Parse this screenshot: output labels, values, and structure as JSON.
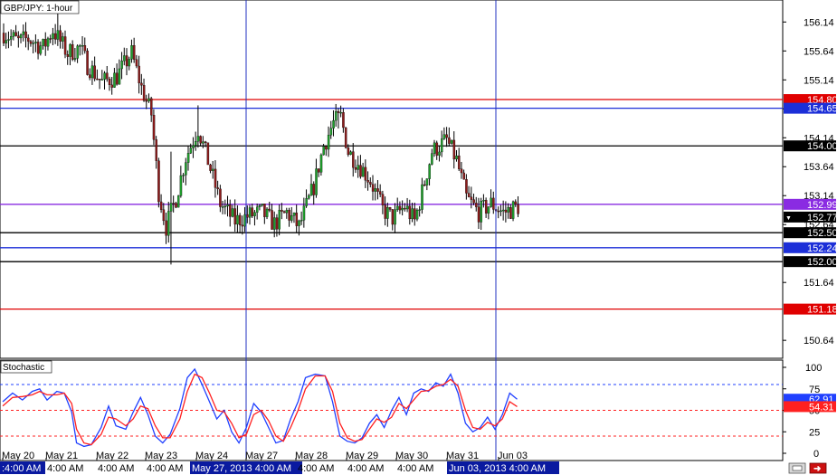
{
  "window": {
    "title": "GBP/JPY: 1-hour"
  },
  "colors": {
    "background": "#ffffff",
    "candle_up": "#1f9e2c",
    "candle_down": "#8b1a1a",
    "wick": "#000000",
    "line_red": "#e00000",
    "line_blue": "#1c2fd8",
    "line_black": "#000000",
    "line_purple": "#8a2be2",
    "stoch_k": "#2040ff",
    "stoch_d": "#ff2020",
    "stoch_level_blue": "#2040ff",
    "stoch_level_red": "#ff2020",
    "crosshair": "#2030c0",
    "highlight_label_bg": "#0a1aa0",
    "price_label_current_bg": "#000000"
  },
  "chart_data": [
    {
      "type": "candlestick",
      "title": "GBP/JPY: 1-hour",
      "ylim": [
        150.33,
        156.52
      ],
      "yticks": [
        156.14,
        155.64,
        155.14,
        154.64,
        154.14,
        153.64,
        153.14,
        152.64,
        151.64,
        150.64
      ],
      "horizontal_lines": [
        {
          "value": 154.8,
          "label": "154.80",
          "color": "red"
        },
        {
          "value": 154.65,
          "label": "154.65",
          "color": "blue"
        },
        {
          "value": 154.0,
          "label": "154.00",
          "color": "black"
        },
        {
          "value": 152.99,
          "label": "152.99",
          "color": "purple"
        },
        {
          "value": 152.5,
          "label": "152.50",
          "color": "black"
        },
        {
          "value": 152.24,
          "label": "152.24",
          "color": "blue"
        },
        {
          "value": 152.0,
          "label": "152.00",
          "color": "black"
        },
        {
          "value": 151.18,
          "label": "151.18",
          "color": "red"
        }
      ],
      "current_price": {
        "value": 152.77,
        "label": "152.77"
      },
      "price_path": [
        [
          0,
          155.95
        ],
        [
          6,
          155.8
        ],
        [
          10,
          155.85
        ],
        [
          16,
          155.7
        ],
        [
          20,
          156.0
        ],
        [
          26,
          155.6
        ],
        [
          31,
          155.7
        ],
        [
          34,
          155.4
        ],
        [
          40,
          155.1
        ],
        [
          46,
          155.2
        ],
        [
          52,
          155.6
        ],
        [
          56,
          155.0
        ],
        [
          60,
          154.55
        ],
        [
          63,
          153.2
        ],
        [
          66,
          152.6
        ],
        [
          70,
          153.1
        ],
        [
          74,
          153.8
        ],
        [
          79,
          154.3
        ],
        [
          84,
          153.6
        ],
        [
          88,
          153.0
        ],
        [
          94,
          152.7
        ],
        [
          100,
          152.8
        ],
        [
          105,
          152.85
        ],
        [
          110,
          152.65
        ],
        [
          115,
          152.85
        ],
        [
          120,
          152.6
        ],
        [
          126,
          153.3
        ],
        [
          130,
          154.0
        ],
        [
          134,
          154.4
        ],
        [
          137,
          154.5
        ],
        [
          140,
          153.9
        ],
        [
          144,
          153.7
        ],
        [
          149,
          153.4
        ],
        [
          154,
          152.9
        ],
        [
          158,
          152.75
        ],
        [
          163,
          152.95
        ],
        [
          167,
          152.7
        ],
        [
          170,
          153.2
        ],
        [
          174,
          153.9
        ],
        [
          180,
          154.1
        ],
        [
          184,
          153.75
        ],
        [
          188,
          153.1
        ],
        [
          193,
          152.85
        ],
        [
          198,
          153.0
        ],
        [
          203,
          152.85
        ],
        [
          209,
          152.95
        ]
      ],
      "spikes": [
        {
          "i": 68,
          "high": 153.9,
          "low": 151.95
        },
        {
          "i": 79,
          "high": 154.7,
          "low": 154.1
        },
        {
          "i": 136,
          "high": 154.65,
          "low": 154.3
        },
        {
          "i": 183,
          "high": 154.2,
          "low": 153.7
        },
        {
          "i": 22,
          "high": 156.4,
          "low": 155.9
        }
      ],
      "candle_count": 210,
      "xlabels_date": [
        "May 20",
        "May 21",
        "May 22",
        "May 23",
        "May 24",
        "May 27",
        "May 28",
        "May 29",
        "May 30",
        "May 31",
        "Jun 03"
      ],
      "xlabels_time": [
        ":4:00 AM",
        "4:00 AM",
        "4:00 AM",
        "4:00 AM",
        "May 27, 2013 4:00 AM",
        "4:00 AM",
        "4:00 AM",
        "4:00 AM",
        "Jun 03, 2013 4:00 AM"
      ],
      "crosshair_labels": [
        "May 27, 2013 4:00 AM",
        "Jun 03, 2013 4:00 AM"
      ]
    },
    {
      "type": "line",
      "title": "Stochastic",
      "ylim": [
        0,
        100
      ],
      "yticks": [
        100,
        75,
        50,
        25,
        0
      ],
      "levels": [
        80,
        20,
        50
      ],
      "current_values": [
        {
          "label": "62.91",
          "value": 62.91,
          "color": "blue"
        },
        {
          "label": "54.31",
          "value": 54.31,
          "color": "red"
        }
      ],
      "series": [
        {
          "name": "%K",
          "color": "blue",
          "points": [
            [
              0,
              60
            ],
            [
              4,
              70
            ],
            [
              8,
              62
            ],
            [
              12,
              72
            ],
            [
              15,
              75
            ],
            [
              18,
              62
            ],
            [
              22,
              72
            ],
            [
              25,
              70
            ],
            [
              28,
              48
            ],
            [
              30,
              12
            ],
            [
              33,
              8
            ],
            [
              36,
              10
            ],
            [
              40,
              30
            ],
            [
              43,
              55
            ],
            [
              46,
              32
            ],
            [
              50,
              28
            ],
            [
              53,
              48
            ],
            [
              56,
              65
            ],
            [
              59,
              45
            ],
            [
              62,
              20
            ],
            [
              65,
              12
            ],
            [
              68,
              22
            ],
            [
              72,
              52
            ],
            [
              75,
              88
            ],
            [
              78,
              98
            ],
            [
              81,
              80
            ],
            [
              84,
              60
            ],
            [
              87,
              40
            ],
            [
              90,
              50
            ],
            [
              93,
              25
            ],
            [
              96,
              12
            ],
            [
              99,
              30
            ],
            [
              102,
              58
            ],
            [
              105,
              48
            ],
            [
              108,
              30
            ],
            [
              111,
              12
            ],
            [
              114,
              15
            ],
            [
              117,
              40
            ],
            [
              120,
              60
            ],
            [
              123,
              88
            ],
            [
              127,
              92
            ],
            [
              131,
              90
            ],
            [
              134,
              60
            ],
            [
              137,
              20
            ],
            [
              140,
              14
            ],
            [
              143,
              12
            ],
            [
              146,
              18
            ],
            [
              149,
              35
            ],
            [
              152,
              45
            ],
            [
              155,
              30
            ],
            [
              158,
              50
            ],
            [
              161,
              65
            ],
            [
              164,
              45
            ],
            [
              167,
              70
            ],
            [
              170,
              75
            ],
            [
              173,
              72
            ],
            [
              176,
              82
            ],
            [
              179,
              78
            ],
            [
              182,
              92
            ],
            [
              185,
              70
            ],
            [
              188,
              35
            ],
            [
              191,
              25
            ],
            [
              194,
              30
            ],
            [
              197,
              42
            ],
            [
              200,
              28
            ],
            [
              203,
              45
            ],
            [
              206,
              70
            ],
            [
              209,
              62.91
            ]
          ]
        },
        {
          "name": "%D",
          "color": "red",
          "points": [
            [
              0,
              55
            ],
            [
              4,
              65
            ],
            [
              8,
              66
            ],
            [
              12,
              68
            ],
            [
              15,
              72
            ],
            [
              18,
              68
            ],
            [
              22,
              68
            ],
            [
              25,
              70
            ],
            [
              28,
              58
            ],
            [
              30,
              28
            ],
            [
              33,
              12
            ],
            [
              36,
              10
            ],
            [
              40,
              22
            ],
            [
              43,
              42
            ],
            [
              46,
              40
            ],
            [
              50,
              32
            ],
            [
              53,
              40
            ],
            [
              56,
              55
            ],
            [
              59,
              52
            ],
            [
              62,
              32
            ],
            [
              65,
              18
            ],
            [
              68,
              18
            ],
            [
              72,
              40
            ],
            [
              75,
              72
            ],
            [
              78,
              92
            ],
            [
              81,
              88
            ],
            [
              84,
              70
            ],
            [
              87,
              50
            ],
            [
              90,
              48
            ],
            [
              93,
              35
            ],
            [
              96,
              18
            ],
            [
              99,
              22
            ],
            [
              102,
              45
            ],
            [
              105,
              50
            ],
            [
              108,
              38
            ],
            [
              111,
              20
            ],
            [
              114,
              14
            ],
            [
              117,
              30
            ],
            [
              120,
              50
            ],
            [
              123,
              75
            ],
            [
              127,
              90
            ],
            [
              131,
              90
            ],
            [
              134,
              72
            ],
            [
              137,
              35
            ],
            [
              140,
              18
            ],
            [
              143,
              14
            ],
            [
              146,
              16
            ],
            [
              149,
              28
            ],
            [
              152,
              40
            ],
            [
              155,
              36
            ],
            [
              158,
              42
            ],
            [
              161,
              58
            ],
            [
              164,
              52
            ],
            [
              167,
              62
            ],
            [
              170,
              72
            ],
            [
              173,
              73
            ],
            [
              176,
              78
            ],
            [
              179,
              80
            ],
            [
              182,
              86
            ],
            [
              185,
              78
            ],
            [
              188,
              50
            ],
            [
              191,
              30
            ],
            [
              194,
              28
            ],
            [
              197,
              36
            ],
            [
              200,
              32
            ],
            [
              203,
              40
            ],
            [
              206,
              60
            ],
            [
              209,
              54.31
            ]
          ]
        }
      ]
    }
  ],
  "toolbar": {
    "icon_left": "screenshot-icon",
    "icon_right": "exit-arrow-icon"
  }
}
